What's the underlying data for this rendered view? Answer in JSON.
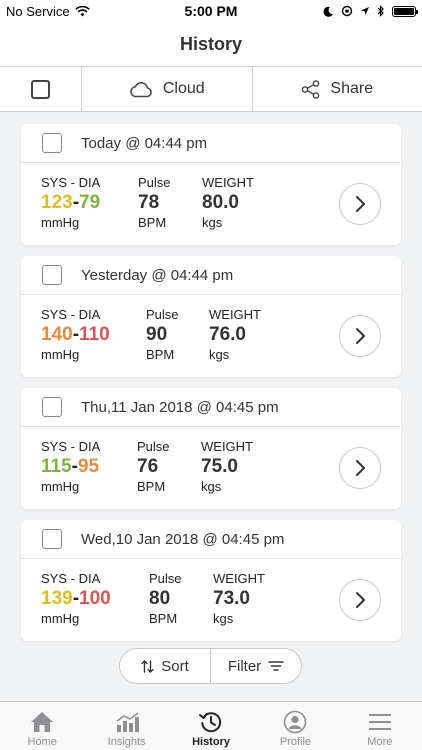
{
  "status_bar": {
    "carrier": "No Service",
    "time": "5:00 PM"
  },
  "header": {
    "title": "History"
  },
  "toolbar": {
    "cloud_label": "Cloud",
    "share_label": "Share"
  },
  "colors": {
    "green": "#7cb53a",
    "yellow": "#e3bd1e",
    "orange": "#f0883a",
    "red": "#e35150"
  },
  "entries": [
    {
      "date": "Today @ 04:44 pm",
      "bp_label": "SYS - DIA",
      "sys": "123",
      "dia": "79",
      "bp_unit": "mmHg",
      "pulse_label": "Pulse",
      "pulse": "78",
      "pulse_unit": "BPM",
      "weight_label": "WEIGHT",
      "weight": "80.0",
      "weight_unit": "kgs"
    },
    {
      "date": "Yesterday @ 04:44 pm",
      "bp_label": "SYS - DIA",
      "sys": "140",
      "dia": "110",
      "bp_unit": "mmHg",
      "pulse_label": "Pulse",
      "pulse": "90",
      "pulse_unit": "BPM",
      "weight_label": "WEIGHT",
      "weight": "76.0",
      "weight_unit": "kgs"
    },
    {
      "date": "Thu,11 Jan 2018 @ 04:45 pm",
      "bp_label": "SYS - DIA",
      "sys": "115",
      "dia": "95",
      "bp_unit": "mmHg",
      "pulse_label": "Pulse",
      "pulse": "76",
      "pulse_unit": "BPM",
      "weight_label": "WEIGHT",
      "weight": "75.0",
      "weight_unit": "kgs"
    },
    {
      "date": "Wed,10 Jan 2018 @ 04:45 pm",
      "bp_label": "SYS - DIA",
      "sys": "139",
      "dia": "100",
      "bp_unit": "mmHg",
      "pulse_label": "Pulse",
      "pulse": "80",
      "pulse_unit": "BPM",
      "weight_label": "WEIGHT",
      "weight": "73.0",
      "weight_unit": "kgs"
    }
  ],
  "actions": {
    "sort_label": "Sort",
    "filter_label": "Filter"
  },
  "tabs": [
    {
      "label": "Home",
      "icon": "home-icon"
    },
    {
      "label": "Insights",
      "icon": "insights-icon"
    },
    {
      "label": "History",
      "icon": "history-icon"
    },
    {
      "label": "Profile",
      "icon": "profile-icon"
    },
    {
      "label": "More",
      "icon": "menu-icon"
    }
  ]
}
